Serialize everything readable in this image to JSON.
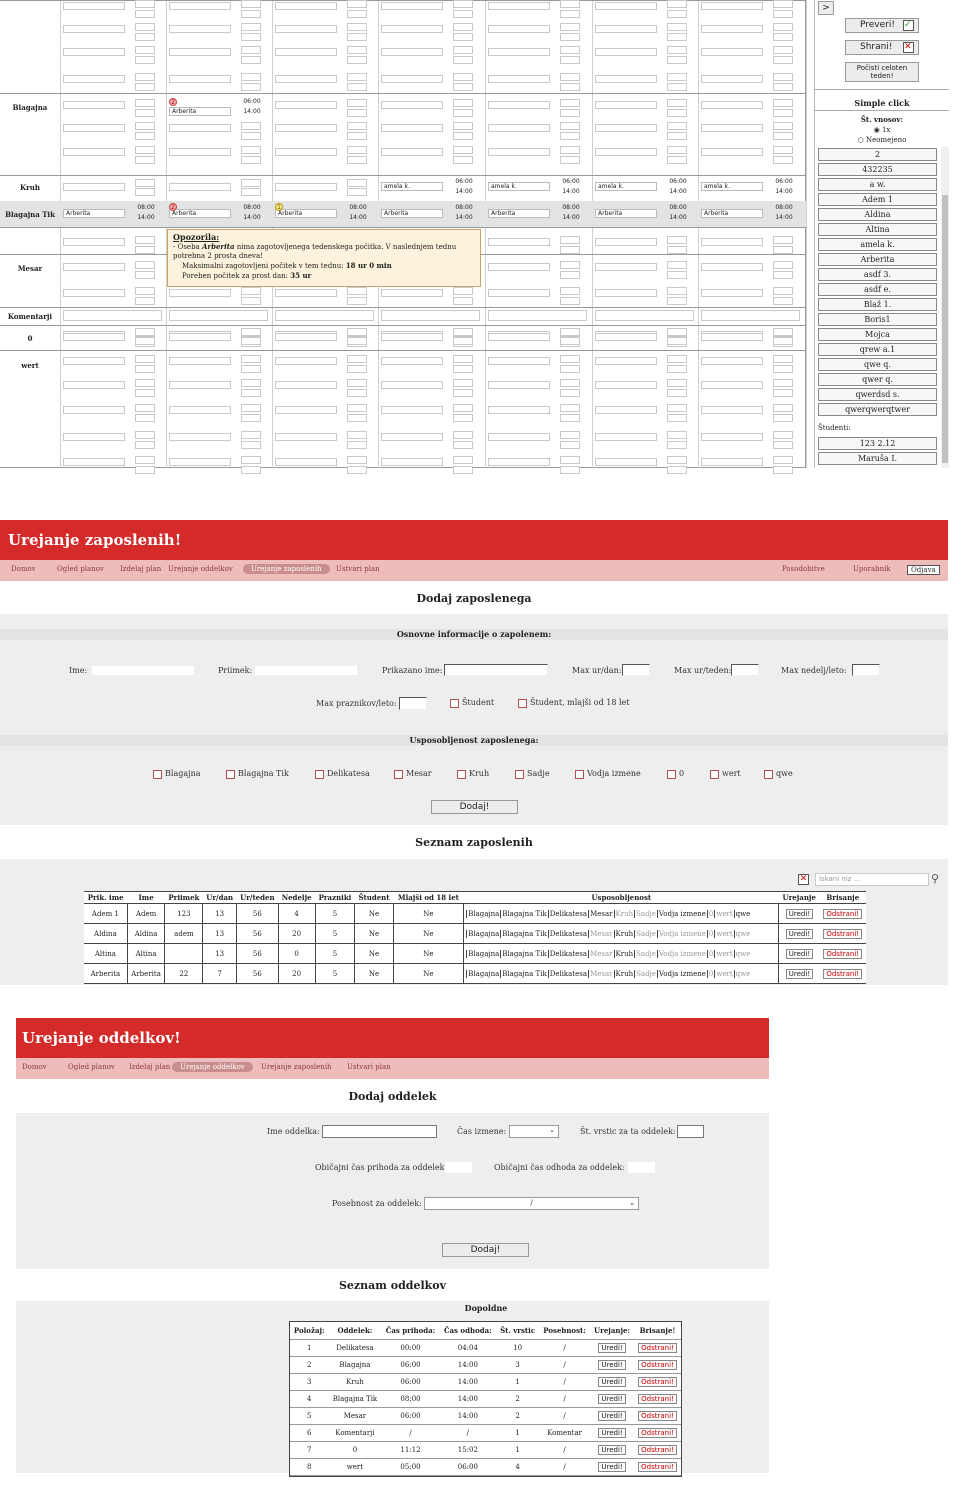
{
  "schedule": {
    "toggle_btn": ">",
    "check_btn": "Preveri!",
    "save_btn": "Shrani!",
    "clear_btn": "Počisti celoten teden!",
    "simple_click_title": "Simple click",
    "entries_label": "Št. vnosov:",
    "radio_1x": "1x",
    "radio_unlimited": "Neomejeno",
    "students_label": "Študenti:",
    "rows": {
      "blagajna": "Blagajna",
      "kruh": "Kruh",
      "blagajna_tik": "Blagajna Tik",
      "mesar": "Mesar",
      "komentarji": "Komentarji",
      "zero": "0",
      "wert": "wert"
    },
    "blagajna_cell": {
      "badge": "2",
      "name": "Arberita",
      "t1": "06:00",
      "t2": "14:00"
    },
    "kruh_cells": [
      {
        "name": "amela k.",
        "t1": "06:00",
        "t2": "14:00"
      },
      {
        "name": "amela k.",
        "t1": "06:00",
        "t2": "14:00"
      },
      {
        "name": "amela k.",
        "t1": "06:00",
        "t2": "14:00"
      },
      {
        "name": "amela k.",
        "t1": "06:00",
        "t2": "14:00"
      }
    ],
    "tik_cells": [
      {
        "badge": "",
        "name": "Arberita",
        "t1": "08:00",
        "t2": "14:00"
      },
      {
        "badge": "2",
        "name": "Arberita",
        "t1": "08:00",
        "t2": "14:00"
      },
      {
        "badge": "1",
        "name": "Arberita",
        "t1": "08:00",
        "t2": "14:00"
      },
      {
        "badge": "",
        "name": "Arberita",
        "t1": "08:00",
        "t2": "14:00"
      },
      {
        "badge": "",
        "name": "Arberita",
        "t1": "08:00",
        "t2": "14:00"
      },
      {
        "badge": "",
        "name": "Arberita",
        "t1": "08:00",
        "t2": "14:00"
      },
      {
        "badge": "",
        "name": "Arberita",
        "t1": "08:00",
        "t2": "14:00"
      }
    ],
    "tooltip": {
      "title": "Opozorila:",
      "line1_pre": "- Oseba ",
      "line1_name": "Arberita",
      "line1_post": " nima zagotovljenega tedenskega počitka. V naslednjem tednu potrebna 2 prosta dneva!",
      "line2_pre": "Maksimalni zagotovljeni počitek v tem tednu: ",
      "line2_val": "18 ur 0 min",
      "line3_pre": "Poreben počitek za prost dan: ",
      "line3_val": "35 ur"
    },
    "employees": [
      "2",
      "432235",
      "a w.",
      "Adem 1",
      "Aldina",
      "Altina",
      "amela k.",
      "Arberita",
      "asdf 3.",
      "asdf e.",
      "Blaž 1.",
      "Boris1",
      "Mojca",
      "qrew a.1",
      "qwe q.",
      "qwer q.",
      "qwerdsd s.",
      "qwerqwerqtwer"
    ],
    "students": [
      "123 2.12",
      "Maruša I."
    ]
  },
  "emp_page": {
    "header": "Urejanje zaposlenih!",
    "nav": [
      "Domov",
      "Ogled planov",
      "Izdelaj plan",
      "Urejanje oddelkov",
      "Urejanje zaposlenih",
      "Ustvari plan"
    ],
    "nav_right": [
      "Posodobitve",
      "Uporabnik",
      "Odjava"
    ],
    "add_title": "Dodaj zaposlenega",
    "basic_info": "Osnovne informacije o zapolenem:",
    "fields": {
      "ime": "Ime:",
      "priimek": "Priimek:",
      "prikazano": "Prikazano ime:",
      "max_dan": "Max ur/dan:",
      "max_teden": "Max ur/teden:",
      "max_nedelj": "Max nedelj/leto:",
      "max_praznikov": "Max praznikov/leto:",
      "student": "Študent",
      "student_mlajsi": "Študent, mlajši od 18 let"
    },
    "skills_title": "Usposobljenost zaposlenega:",
    "skills": [
      "Blagajna",
      "Blagajna Tik",
      "Delikatesa",
      "Mesar",
      "Kruh",
      "Sadje",
      "Vodja izmene",
      "0",
      "wert",
      "qwe"
    ],
    "add_btn": "Dodaj!",
    "list_title": "Seznam zaposlenih",
    "search_placeholder": "iskani niz ...",
    "columns": [
      "Prik. ime",
      "Ime",
      "Priimek",
      "Ur/dan",
      "Ur/teden",
      "Nedelje",
      "Prazniki",
      "Študent",
      "Mlajši od 18 let",
      "Usposobljenost",
      "Urejanje",
      "Brisanje"
    ],
    "rows": [
      {
        "prik": "Adem 1",
        "ime": "Adem",
        "priimek": "123",
        "dan": "13",
        "teden": "56",
        "nedelje": "4",
        "prazniki": "5",
        "student": "Ne",
        "mlajsi": "Ne"
      },
      {
        "prik": "Aldina",
        "ime": "Aldina",
        "priimek": "adem",
        "dan": "13",
        "teden": "56",
        "nedelje": "20",
        "prazniki": "5",
        "student": "Ne",
        "mlajsi": "Ne"
      },
      {
        "prik": "Altina",
        "ime": "Altina",
        "priimek": "",
        "dan": "13",
        "teden": "56",
        "nedelje": "0",
        "prazniki": "5",
        "student": "Ne",
        "mlajsi": "Ne"
      },
      {
        "prik": "Arberita",
        "ime": "Arberita",
        "priimek": "22",
        "dan": "7",
        "teden": "56",
        "nedelje": "20",
        "prazniki": "5",
        "student": "Ne",
        "mlajsi": "Ne"
      }
    ],
    "edit_btn": "Uredi!",
    "delete_btn": "Odstrani!"
  },
  "dept_page": {
    "header": "Urejanje oddelkov!",
    "nav": [
      "Domov",
      "Ogled planov",
      "Izdelaj plan",
      "Urejanje oddelkov",
      "Urejanje zaposlenih",
      "Ustvari plan"
    ],
    "add_title": "Dodaj oddelek",
    "fields": {
      "ime": "Ime oddelka:",
      "cas": "Čas izmene:",
      "vrstice": "Št. vrstic za ta oddelek:",
      "prihod": "Običajni čas prihoda za oddelek:",
      "odhod": "Običajni čas odhoda za oddelek:",
      "posebnost": "Posebnost za oddelek:"
    },
    "posebnost_value": "/",
    "add_btn": "Dodaj!",
    "list_title": "Seznam oddelkov",
    "group": "Dopoldne",
    "columns": [
      "Položaj:",
      "Oddelek:",
      "Čas prihoda:",
      "Čas odhoda:",
      "Št. vrstic",
      "Posebnost:",
      "Urejanje:",
      "Brisanje!"
    ],
    "rows": [
      {
        "pos": "1",
        "odd": "Delikatesa",
        "prihod": "00:00",
        "odhod": "04:04",
        "vrst": "10",
        "pos2": "/"
      },
      {
        "pos": "2",
        "odd": "Blagajna",
        "prihod": "06:00",
        "odhod": "14:00",
        "vrst": "3",
        "pos2": "/"
      },
      {
        "pos": "3",
        "odd": "Kruh",
        "prihod": "06:00",
        "odhod": "14:00",
        "vrst": "1",
        "pos2": "/"
      },
      {
        "pos": "4",
        "odd": "Blagajna Tik",
        "prihod": "08:00",
        "odhod": "14:00",
        "vrst": "2",
        "pos2": "/"
      },
      {
        "pos": "5",
        "odd": "Mesar",
        "prihod": "06:00",
        "odhod": "14:00",
        "vrst": "2",
        "pos2": "/"
      },
      {
        "pos": "6",
        "odd": "Komentarji",
        "prihod": "/",
        "odhod": "/",
        "vrst": "1",
        "pos2": "Komentar"
      },
      {
        "pos": "7",
        "odd": "0",
        "prihod": "11:12",
        "odhod": "15:02",
        "vrst": "1",
        "pos2": "/"
      },
      {
        "pos": "8",
        "odd": "wert",
        "prihod": "05:00",
        "odhod": "06:00",
        "vrst": "4",
        "pos2": "/"
      }
    ],
    "edit_btn": "Uredi!",
    "delete_btn": "Odstrani!"
  }
}
